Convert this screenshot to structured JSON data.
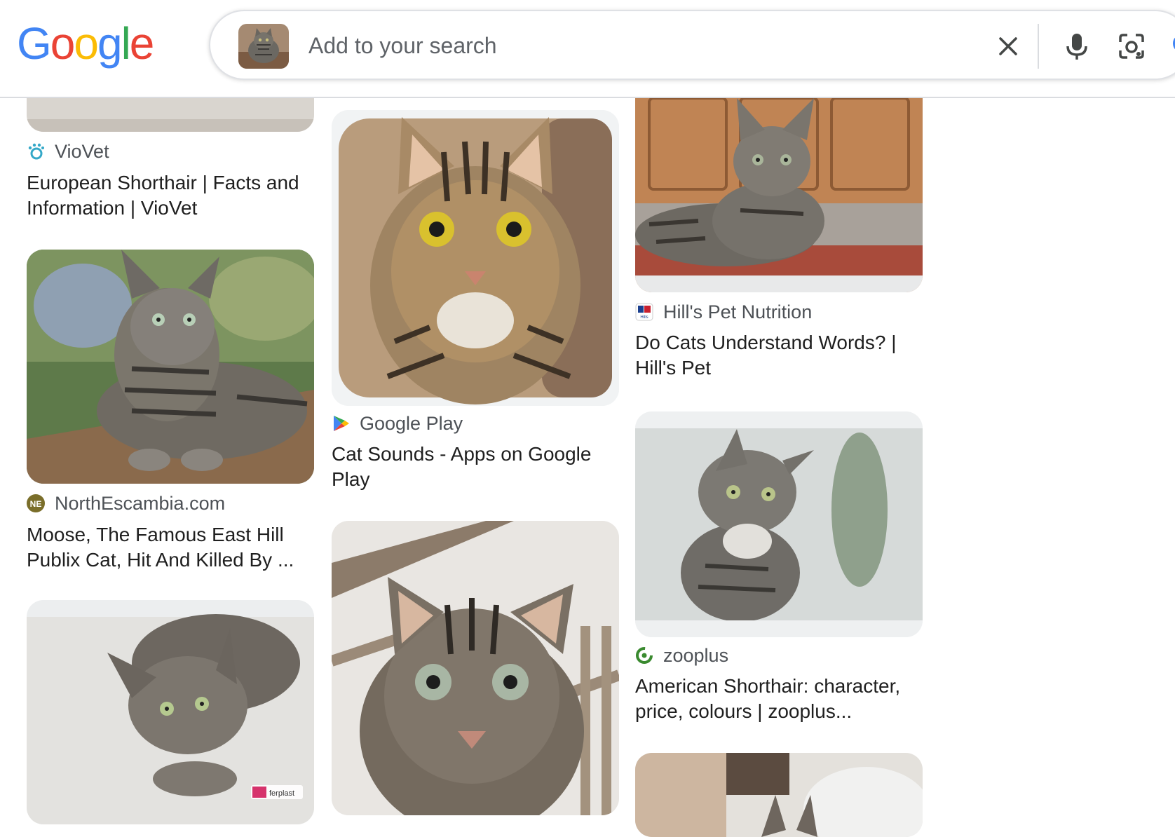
{
  "header": {
    "logo_letters": [
      "G",
      "o",
      "o",
      "g",
      "l",
      "e"
    ],
    "search_placeholder": "Add to your search",
    "search_value": ""
  },
  "colors": {
    "google_blue": "#4285F4",
    "google_red": "#EA4335",
    "google_yellow": "#FBBC05",
    "google_green": "#34A853",
    "icon_gray": "#444746",
    "source_text": "#4d5156",
    "title_text": "#1f1f1f"
  },
  "icons": {
    "clear": "close-icon",
    "voice": "microphone-icon",
    "lens": "camera-lens-icon",
    "search": "search-icon"
  },
  "results": [
    {
      "source": "VioVet",
      "favicon": "viovet-paw-icon",
      "title": "European Shorthair | Facts and Information | VioVet"
    },
    {
      "source": "NorthEscambia.com",
      "favicon": "northescambia-ne-icon",
      "favicon_text": "NE",
      "title": "Moose, The Famous East Hill Publix Cat, Hit And Killed By ..."
    },
    {
      "source": "",
      "title": "",
      "watermark": "ferplast"
    },
    {
      "source": "Google Play",
      "favicon": "google-play-icon",
      "title": "Cat Sounds - Apps on Google Play"
    },
    {
      "source": "",
      "title": ""
    },
    {
      "source": "Hill's Pet Nutrition",
      "favicon": "hills-logo-icon",
      "favicon_text": "Hills",
      "title": "Do Cats Understand Words? | Hill's Pet"
    },
    {
      "source": "zooplus",
      "favicon": "zooplus-icon",
      "title": "American Shorthair: character, price, colours | zooplus..."
    },
    {
      "source": "",
      "title": ""
    }
  ]
}
